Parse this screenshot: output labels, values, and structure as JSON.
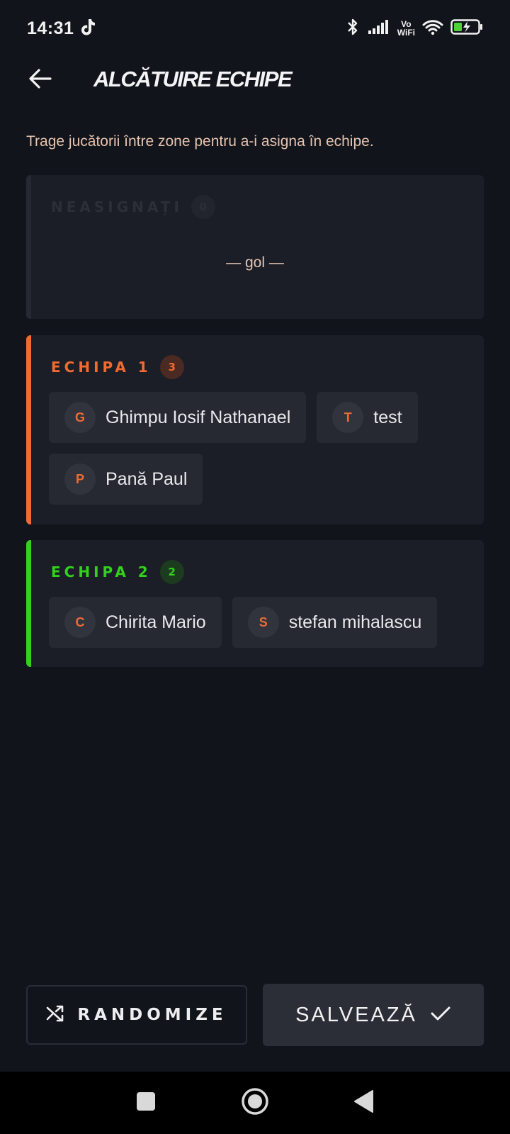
{
  "status_bar": {
    "time": "14:31",
    "vowifi_top": "Vo",
    "vowifi_bottom": "WiFi",
    "battery_color": "#4cd137"
  },
  "header": {
    "title": "ALCĂTUIRE ECHIPE"
  },
  "instructions": "Trage jucătorii între zone pentru a-i asigna în echipe.",
  "unassigned": {
    "title": "NEASIGNAȚI",
    "count": "0",
    "empty_text": "— gol —",
    "accent": "#262932"
  },
  "team1": {
    "title": "ECHIPA 1",
    "count": "3",
    "accent": "#f26a30",
    "players": [
      {
        "initial": "G",
        "name": "Ghimpu Iosif Nathanael"
      },
      {
        "initial": "T",
        "name": "test"
      },
      {
        "initial": "P",
        "name": "Pană Paul"
      }
    ]
  },
  "team2": {
    "title": "ECHIPA 2",
    "count": "2",
    "accent": "#33d11c",
    "players": [
      {
        "initial": "C",
        "name": "Chirita Mario"
      },
      {
        "initial": "S",
        "name": "stefan mihalascu"
      }
    ]
  },
  "actions": {
    "randomize_label": "RANDOMIZE",
    "save_label": "SALVEAZĂ"
  }
}
